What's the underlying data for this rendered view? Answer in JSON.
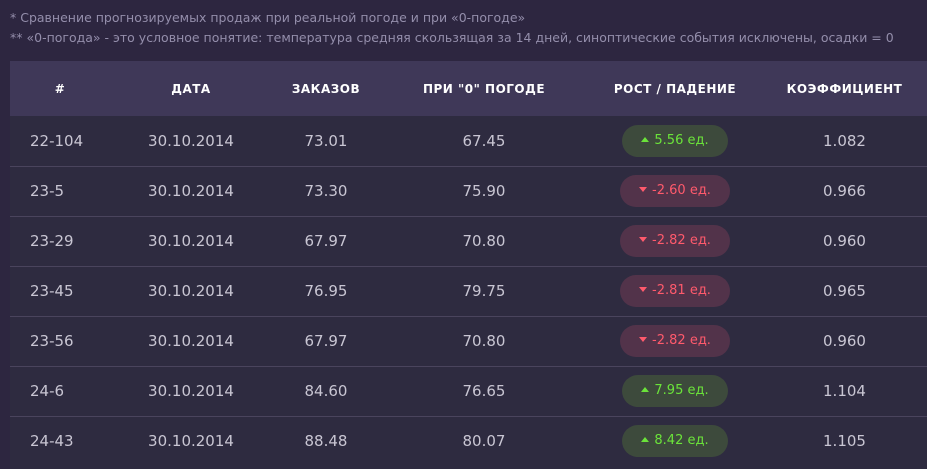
{
  "notes": {
    "line1": "* Сравнение прогнозируемых продаж при реальной погоде и при «0-погоде»",
    "line2": "** «0-погода» - это условное понятие: температура средняя скользящая за 14 дней, синоптические события исключены, осадки = 0"
  },
  "table": {
    "headers": [
      "#",
      "ДАТА",
      "ЗАКАЗОВ",
      "ПРИ \"0\" ПОГОДЕ",
      "РОСТ / ПАДЕНИЕ",
      "КОЭФФИЦИЕНТ"
    ],
    "rows": [
      {
        "id": "22-104",
        "date": "30.10.2014",
        "orders": "73.01",
        "zero": "67.45",
        "change": "5.56 ед.",
        "direction": "up",
        "coef": "1.082"
      },
      {
        "id": "23-5",
        "date": "30.10.2014",
        "orders": "73.30",
        "zero": "75.90",
        "change": "-2.60 ед.",
        "direction": "down",
        "coef": "0.966"
      },
      {
        "id": "23-29",
        "date": "30.10.2014",
        "orders": "67.97",
        "zero": "70.80",
        "change": "-2.82 ед.",
        "direction": "down",
        "coef": "0.960"
      },
      {
        "id": "23-45",
        "date": "30.10.2014",
        "orders": "76.95",
        "zero": "79.75",
        "change": "-2.81 ед.",
        "direction": "down",
        "coef": "0.965"
      },
      {
        "id": "23-56",
        "date": "30.10.2014",
        "orders": "67.97",
        "zero": "70.80",
        "change": "-2.82 ед.",
        "direction": "down",
        "coef": "0.960"
      },
      {
        "id": "24-6",
        "date": "30.10.2014",
        "orders": "84.60",
        "zero": "76.65",
        "change": "7.95 ед.",
        "direction": "up",
        "coef": "1.104"
      },
      {
        "id": "24-43",
        "date": "30.10.2014",
        "orders": "88.48",
        "zero": "80.07",
        "change": "8.42 ед.",
        "direction": "up",
        "coef": "1.105"
      }
    ]
  },
  "colors": {
    "background": "#2d2640",
    "header": "#3f3858",
    "up_text": "#6be43a",
    "up_bg": "#3d4a3c",
    "down_text": "#ff5a6c",
    "down_bg": "#52334a"
  }
}
